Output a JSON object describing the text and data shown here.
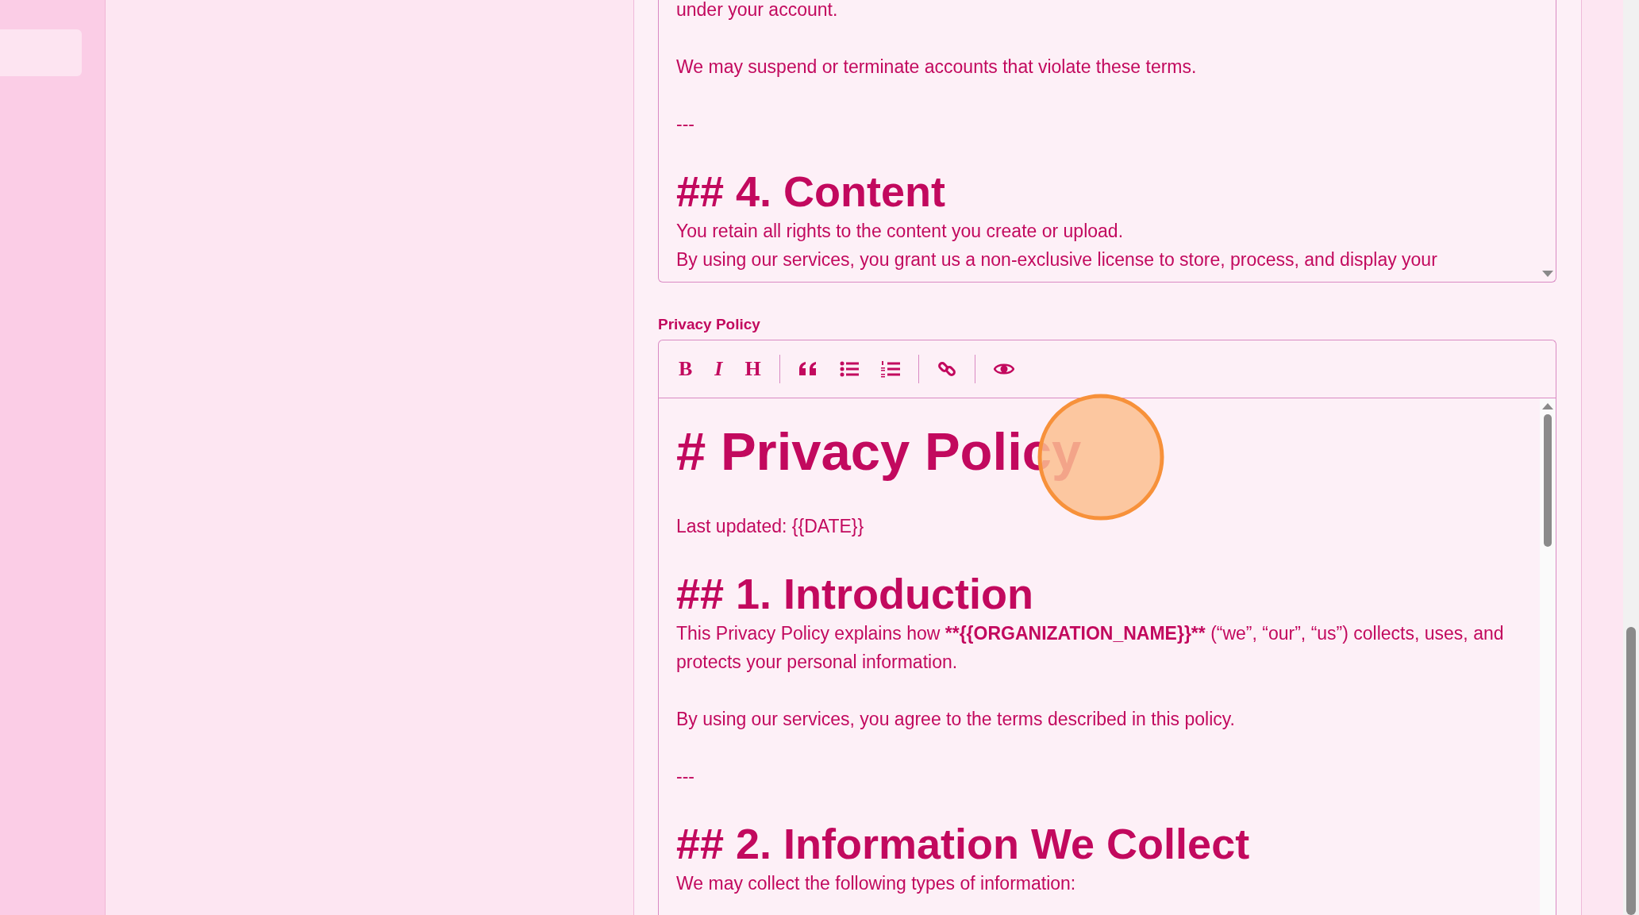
{
  "sidebar": {
    "items": [
      {
        "selected": false
      }
    ]
  },
  "terms_editor": {
    "lines": [
      {
        "kind": "p",
        "segments": [
          {
            "text": "under your account.",
            "bold": false
          }
        ]
      },
      {
        "kind": "blank"
      },
      {
        "kind": "p",
        "segments": [
          {
            "text": "We may suspend or terminate accounts that violate these terms.",
            "bold": false
          }
        ]
      },
      {
        "kind": "blank"
      },
      {
        "kind": "p",
        "segments": [
          {
            "text": "---",
            "bold": false
          }
        ]
      },
      {
        "kind": "blank"
      },
      {
        "kind": "h2",
        "text": "## 4. Content"
      },
      {
        "kind": "p",
        "segments": [
          {
            "text": "You retain all rights to the content you create or upload.",
            "bold": false
          }
        ]
      },
      {
        "kind": "p",
        "segments": [
          {
            "text": "By using our services, you grant us a non-exclusive license to store, process, and display your",
            "bold": false
          }
        ]
      }
    ]
  },
  "privacy_editor": {
    "label": "Privacy Policy",
    "toolbar": [
      {
        "kind": "glyph",
        "label": "B"
      },
      {
        "kind": "glyph",
        "label": "I"
      },
      {
        "kind": "glyph",
        "label": "H"
      },
      {
        "kind": "separator"
      },
      {
        "kind": "quote"
      },
      {
        "kind": "bullets"
      },
      {
        "kind": "numbers"
      },
      {
        "kind": "separator"
      },
      {
        "kind": "link"
      },
      {
        "kind": "separator"
      },
      {
        "kind": "preview"
      }
    ],
    "lines": [
      {
        "kind": "h1",
        "text": "# Privacy Policy"
      },
      {
        "kind": "blank"
      },
      {
        "kind": "p",
        "segments": [
          {
            "text": "Last updated: {{DATE}}",
            "bold": false
          }
        ]
      },
      {
        "kind": "blank"
      },
      {
        "kind": "h2",
        "text": "## 1. Introduction"
      },
      {
        "kind": "p",
        "segments": [
          {
            "text": "This Privacy Policy explains how ",
            "bold": false
          },
          {
            "text": "**{{ORGANIZATION_NAME}}**",
            "bold": true
          },
          {
            "text": " (“we”, “our”, “us”) collects, uses, and protects your personal information.",
            "bold": false
          }
        ]
      },
      {
        "kind": "blank"
      },
      {
        "kind": "p",
        "segments": [
          {
            "text": "By using our services, you agree to the terms described in this policy.",
            "bold": false
          }
        ]
      },
      {
        "kind": "blank"
      },
      {
        "kind": "p",
        "segments": [
          {
            "text": "---",
            "bold": false
          }
        ]
      },
      {
        "kind": "blank"
      },
      {
        "kind": "h2",
        "text": "## 2. Information We Collect"
      },
      {
        "kind": "p",
        "segments": [
          {
            "text": "We may collect the following types of information:",
            "bold": false
          }
        ]
      }
    ]
  }
}
